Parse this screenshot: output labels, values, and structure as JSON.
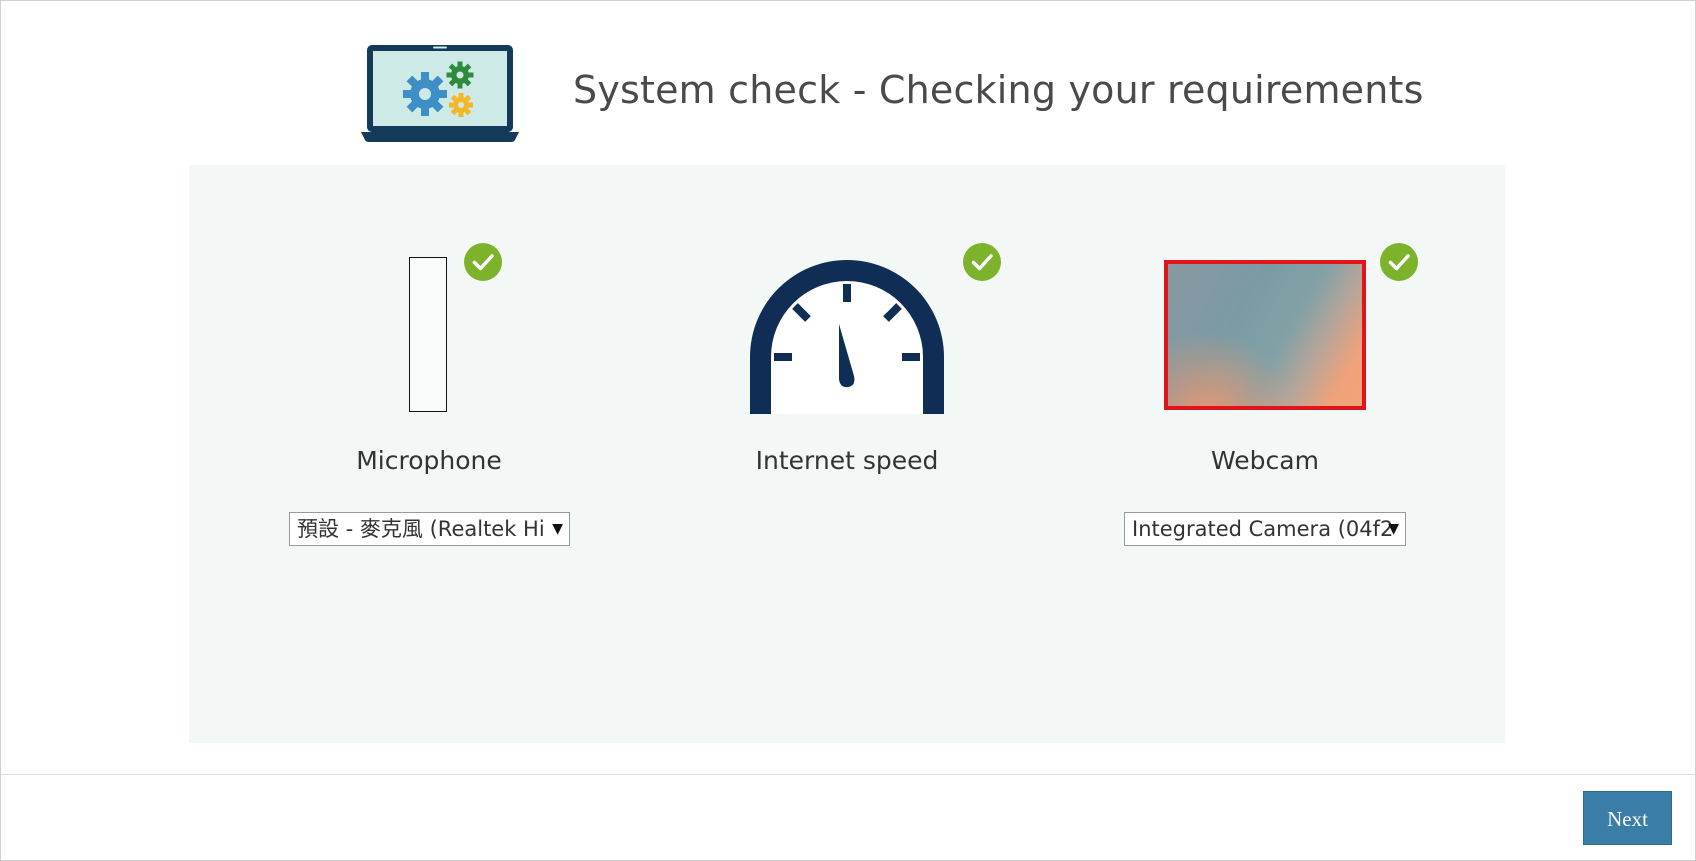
{
  "header": {
    "title": "System check - Checking your requirements",
    "icon": "laptop-gears-icon"
  },
  "checks": [
    {
      "label": "Microphone",
      "status": "passed",
      "status_icon": "checkmark-icon",
      "device_select": "預設 - 麥克風 (Realtek Hi",
      "meter_level": 0
    },
    {
      "label": "Internet speed",
      "status": "passed",
      "status_icon": "checkmark-icon",
      "icon": "speedometer-icon"
    },
    {
      "label": "Webcam",
      "status": "passed",
      "status_icon": "checkmark-icon",
      "device_select": "Integrated Camera (04f2"
    }
  ],
  "footer": {
    "next_label": "Next"
  },
  "colors": {
    "panel_bg": "#f3f8f6",
    "check_green": "#7cb32b",
    "gauge_navy": "#0f2d55",
    "webcam_border": "#e0141b",
    "button_blue": "#3a7ea8"
  }
}
